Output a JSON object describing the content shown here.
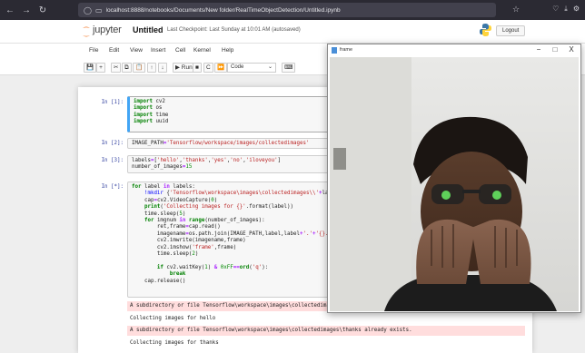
{
  "browser": {
    "url": "localhost:8888/notebooks/Documents/New folder/RealTimeObjectDetection/Untitled.ipynb"
  },
  "jupyter": {
    "brand": "jupyter",
    "notebook_title": "Untitled",
    "checkpoint": "Last Checkpoint: Last Sunday at 10:01 AM  (autosaved)",
    "logout": "Logout"
  },
  "menu": [
    "File",
    "Edit",
    "View",
    "Insert",
    "Cell",
    "Kernel",
    "Help"
  ],
  "toolbar": {
    "save": "💾",
    "add": "+",
    "cut": "✂",
    "copy": "⧉",
    "paste": "📋",
    "up": "↑",
    "down": "↓",
    "run": "▶ Run",
    "stop": "■",
    "restart": "C",
    "fastforward": "⏩",
    "cell_type": "Code",
    "keyboard": "⌨"
  },
  "cells": [
    {
      "prompt": "In [1]:"
    },
    {
      "prompt": "In [2]:"
    },
    {
      "prompt": "In [3]:"
    },
    {
      "prompt": "In [*]:"
    }
  ],
  "outputs": {
    "err1": "A subdirectory or file Tensorflow\\workspace\\images\\collectedimages\\hello already exists.",
    "out1": "Collecting images for hello",
    "err2": "A subdirectory or file Tensorflow\\workspace\\images\\collectedimages\\thanks already exists.",
    "out2": "Collecting images for thanks"
  },
  "frame_window": {
    "title": "frame",
    "minimize": "−",
    "maximize": "□",
    "close": "X"
  },
  "colors": {
    "browser_bar": "#2b2a33",
    "prompt_in": "#303f9f",
    "stderr_bg": "#ffdddd",
    "selected_border": "#42a5f5"
  }
}
